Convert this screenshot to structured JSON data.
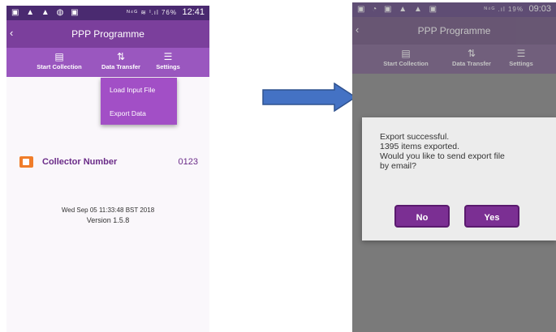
{
  "left_screen": {
    "status_bar": {
      "left_icons": "▣ ▲ ▲ ◍ ▣",
      "right_icons": "ᴺ⁴ᴳ  ≋  ᴵ.ıl 76%",
      "time": "12:41"
    },
    "title": "PPP Programme",
    "back_icon": "‹",
    "toolbar": {
      "start_collection": "Start Collection",
      "data_transfer": "Data Transfer",
      "settings": "Settings"
    },
    "menu": {
      "load_input_file": "Load Input File",
      "export_data": "Export Data"
    },
    "collector_label": "Collector Number",
    "collector_value": "0123",
    "date": "Wed Sep 05 11:33:48 BST 2018",
    "version": "Version 1.5.8"
  },
  "right_screen": {
    "status_bar": {
      "left_icons": "▣ ◔ ▣ ▲ ▲ ▣",
      "right_icons": "ᴺ⁴ᴳ .ıl 19%",
      "time": "09:03"
    },
    "title": "PPP Programme",
    "back_icon": "‹",
    "toolbar": {
      "start_collection": "Start Collection",
      "data_transfer": "Data Transfer",
      "settings": "Settings"
    },
    "dialog": {
      "line1": "Export successful.",
      "line2": "1395 items exported.",
      "line3": "Would you like to send export file",
      "line4": "by email?",
      "no_label": "No",
      "yes_label": "Yes"
    }
  },
  "colors": {
    "status_bar": "#4a2a70",
    "title_bar": "#7b3f9c",
    "toolbar": "#9a57bf",
    "arrow": "#4472c4",
    "dialog_button": "#7b2f93"
  }
}
